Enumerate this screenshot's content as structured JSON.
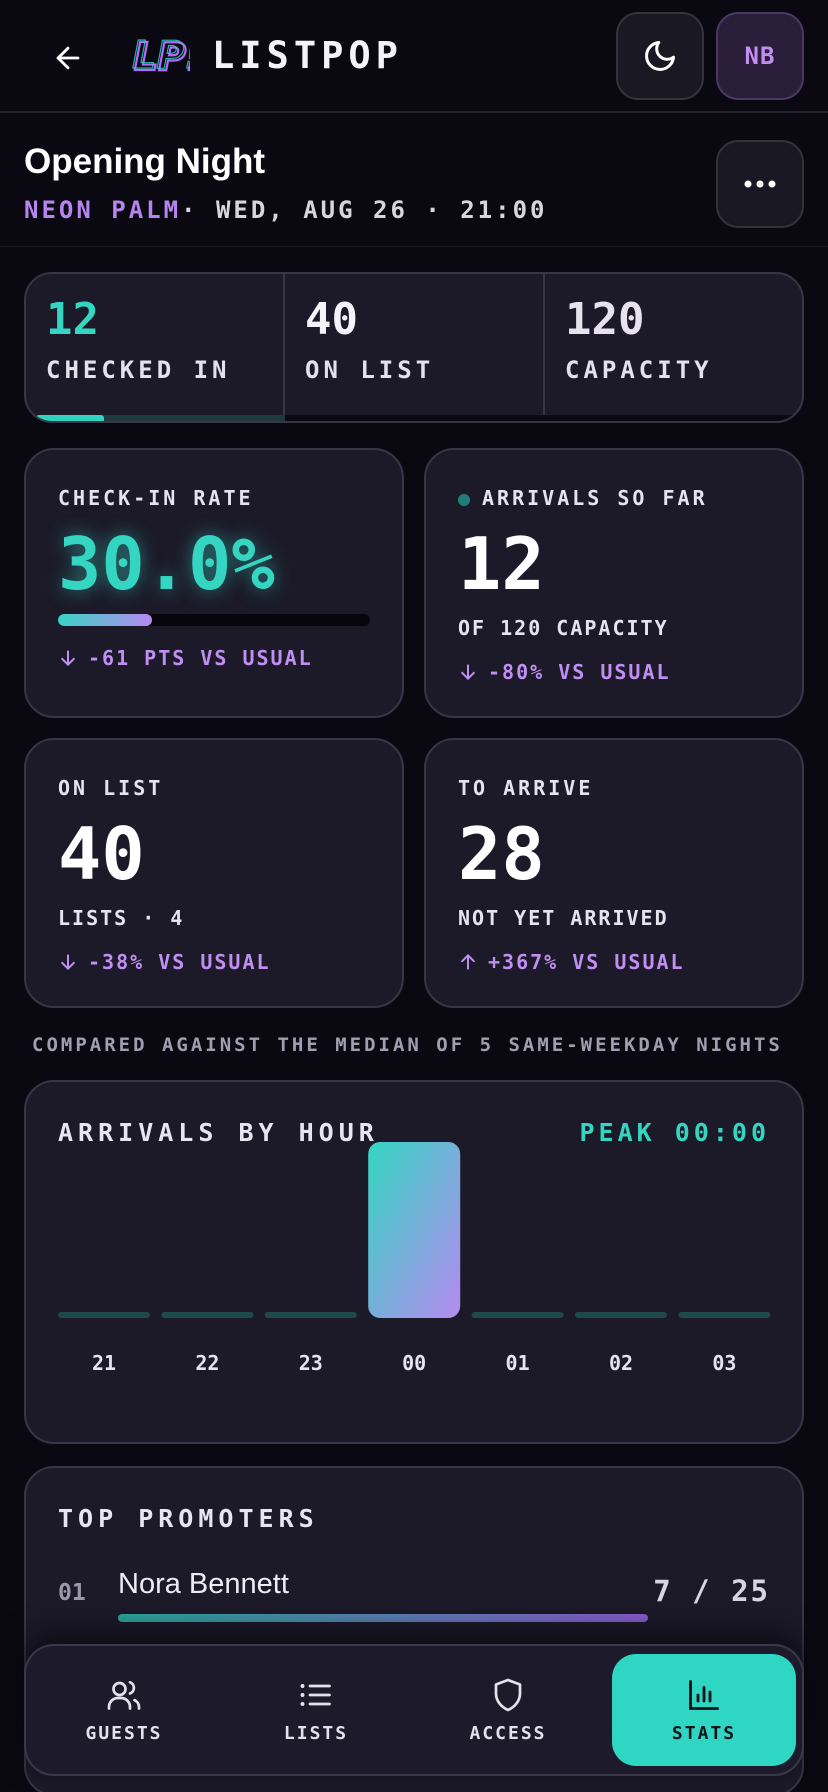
{
  "header": {
    "brand": "LISTPOP",
    "logo_text": "LP!",
    "avatar_initials": "NB"
  },
  "event": {
    "title": "Opening Night",
    "venue": "NEON PALM",
    "datetime": "· WED, AUG 26 · 21:00"
  },
  "summary": {
    "checked_in": "12",
    "checked_in_label": "CHECKED IN",
    "on_list": "40",
    "on_list_label": "ON LIST",
    "capacity": "120",
    "capacity_label": "CAPACITY",
    "checked_in_fraction_of_capacity": 0.1
  },
  "cards": {
    "rate": {
      "label": "CHECK-IN RATE",
      "value": "30.0%",
      "fraction": 0.3,
      "delta": "-61 PTS VS USUAL"
    },
    "arrivals": {
      "label": "ARRIVALS SO FAR",
      "value": "12",
      "sub": "OF 120 CAPACITY",
      "delta": "-80% VS USUAL"
    },
    "onlist": {
      "label": "ON LIST",
      "value": "40",
      "sub": "LISTS · 4",
      "delta": "-38% VS USUAL"
    },
    "toarrive": {
      "label": "TO ARRIVE",
      "value": "28",
      "sub": "NOT YET ARRIVED",
      "delta": "+367% VS USUAL"
    }
  },
  "footnote": "COMPARED AGAINST THE MEDIAN OF 5 SAME-WEEKDAY NIGHTS",
  "chart_data": {
    "type": "bar",
    "title": "ARRIVALS BY HOUR",
    "annotation": "PEAK 00:00",
    "categories": [
      "21",
      "22",
      "23",
      "00",
      "01",
      "02",
      "03"
    ],
    "values": [
      0,
      0,
      0,
      12,
      0,
      0,
      0
    ],
    "colors": {
      "bar": "#34d6c2",
      "bar_end": "#b58af0",
      "empty": "#1f4a4d"
    }
  },
  "promoters": {
    "title": "TOP PROMOTERS",
    "items": [
      {
        "rank": "01",
        "name": "Nora Bennett",
        "count": "7 / 25",
        "fraction": 0.28
      }
    ]
  },
  "nav": {
    "items": [
      {
        "label": "GUESTS",
        "icon": "users-icon"
      },
      {
        "label": "LISTS",
        "icon": "list-icon"
      },
      {
        "label": "ACCESS",
        "icon": "shield-icon"
      },
      {
        "label": "STATS",
        "icon": "bar-chart-icon",
        "active": true
      }
    ]
  }
}
